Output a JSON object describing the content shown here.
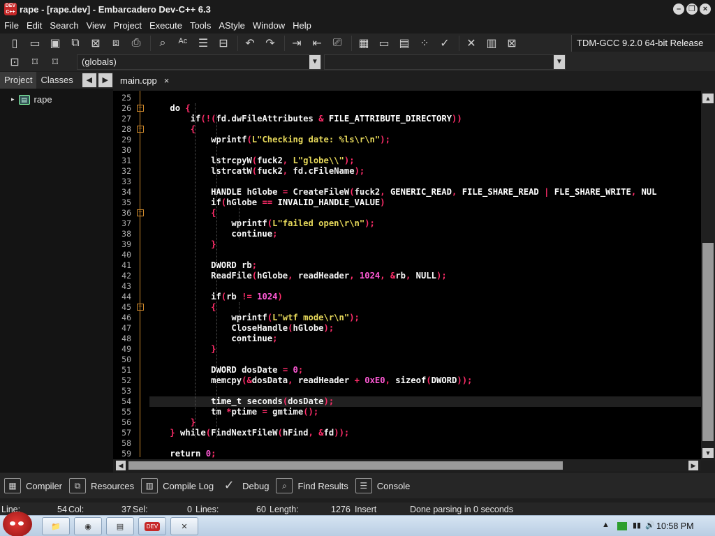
{
  "window": {
    "title": "rape - [rape.dev] - Embarcadero Dev-C++ 6.3",
    "app_icon_label": "DEV C++"
  },
  "menu": [
    "File",
    "Edit",
    "Search",
    "View",
    "Project",
    "Execute",
    "Tools",
    "AStyle",
    "Window",
    "Help"
  ],
  "compiler_label": "TDM-GCC 9.2.0 64-bit Release",
  "scope_combo": "(globals)",
  "left_tabs": [
    "Project",
    "Classes"
  ],
  "project_tree": {
    "root": "rape"
  },
  "editor_tab": {
    "label": "main.cpp",
    "close": "×"
  },
  "active_line": 54,
  "code_lines": [
    {
      "n": "25",
      "html": ""
    },
    {
      "n": "26",
      "html": "    do {"
    },
    {
      "n": "27",
      "html": "        if(!(fd.dwFileAttributes & FILE_ATTRIBUTE_DIRECTORY))"
    },
    {
      "n": "28",
      "html": "        {"
    },
    {
      "n": "29",
      "html": "            wprintf(L\"Checking date: %ls\\r\\n\");"
    },
    {
      "n": "30",
      "html": ""
    },
    {
      "n": "31",
      "html": "            lstrcpyW(fuck2, L\"globe\\\\\");"
    },
    {
      "n": "32",
      "html": "            lstrcatW(fuck2, fd.cFileName);"
    },
    {
      "n": "33",
      "html": ""
    },
    {
      "n": "34",
      "html": "            HANDLE hGlobe = CreateFileW(fuck2, GENERIC_READ, FILE_SHARE_READ | FLE_SHARE_WRITE, NUL"
    },
    {
      "n": "35",
      "html": "            if(hGlobe == INVALID_HANDLE_VALUE)"
    },
    {
      "n": "36",
      "html": "            {"
    },
    {
      "n": "37",
      "html": "                wprintf(L\"failed open\\r\\n\");"
    },
    {
      "n": "38",
      "html": "                continue;"
    },
    {
      "n": "39",
      "html": "            }"
    },
    {
      "n": "40",
      "html": ""
    },
    {
      "n": "41",
      "html": "            DWORD rb;"
    },
    {
      "n": "42",
      "html": "            ReadFile(hGlobe, readHeader, 1024, &rb, NULL);"
    },
    {
      "n": "43",
      "html": ""
    },
    {
      "n": "44",
      "html": "            if(rb != 1024)"
    },
    {
      "n": "45",
      "html": "            {"
    },
    {
      "n": "46",
      "html": "                wprintf(L\"wtf mode\\r\\n\");"
    },
    {
      "n": "47",
      "html": "                CloseHandle(hGlobe);"
    },
    {
      "n": "48",
      "html": "                continue;"
    },
    {
      "n": "49",
      "html": "            }"
    },
    {
      "n": "50",
      "html": ""
    },
    {
      "n": "51",
      "html": "            DWORD dosDate = 0;"
    },
    {
      "n": "52",
      "html": "            memcpy(&dosData, readHeader + 0xE0, sizeof(DWORD));"
    },
    {
      "n": "53",
      "html": ""
    },
    {
      "n": "54",
      "html": "            time_t seconds(dosDate);"
    },
    {
      "n": "55",
      "html": "            tm *ptime = gmtime();"
    },
    {
      "n": "56",
      "html": "        }"
    },
    {
      "n": "57",
      "html": "    } while(FindNextFileW(hFind, &fd));"
    },
    {
      "n": "58",
      "html": ""
    },
    {
      "n": "59",
      "html": "    return 0;"
    }
  ],
  "bottom_tabs": [
    {
      "label": "Compiler",
      "icon": "grid-icon"
    },
    {
      "label": "Resources",
      "icon": "resources-icon"
    },
    {
      "label": "Compile Log",
      "icon": "chart-icon"
    },
    {
      "label": "Debug",
      "icon": "check-icon"
    },
    {
      "label": "Find Results",
      "icon": "find-icon"
    },
    {
      "label": "Console",
      "icon": "console-icon"
    }
  ],
  "status": {
    "line_label": "Line:",
    "line_value": "54",
    "col_label": "Col:",
    "col_value": "37",
    "sel_label": "Sel:",
    "sel_value": "0",
    "lines_label": "Lines:",
    "lines_value": "60",
    "length_label": "Length:",
    "length_value": "1276",
    "mode": "Insert",
    "message": "Done parsing in 0 seconds"
  },
  "taskbar": {
    "clock": "10:58 PM"
  },
  "colors": {
    "background": "#000000",
    "keyword_symbol": "#ff2d6a",
    "string": "#e6d85a",
    "number": "#ff5ad6",
    "fold": "#d08a2c"
  }
}
